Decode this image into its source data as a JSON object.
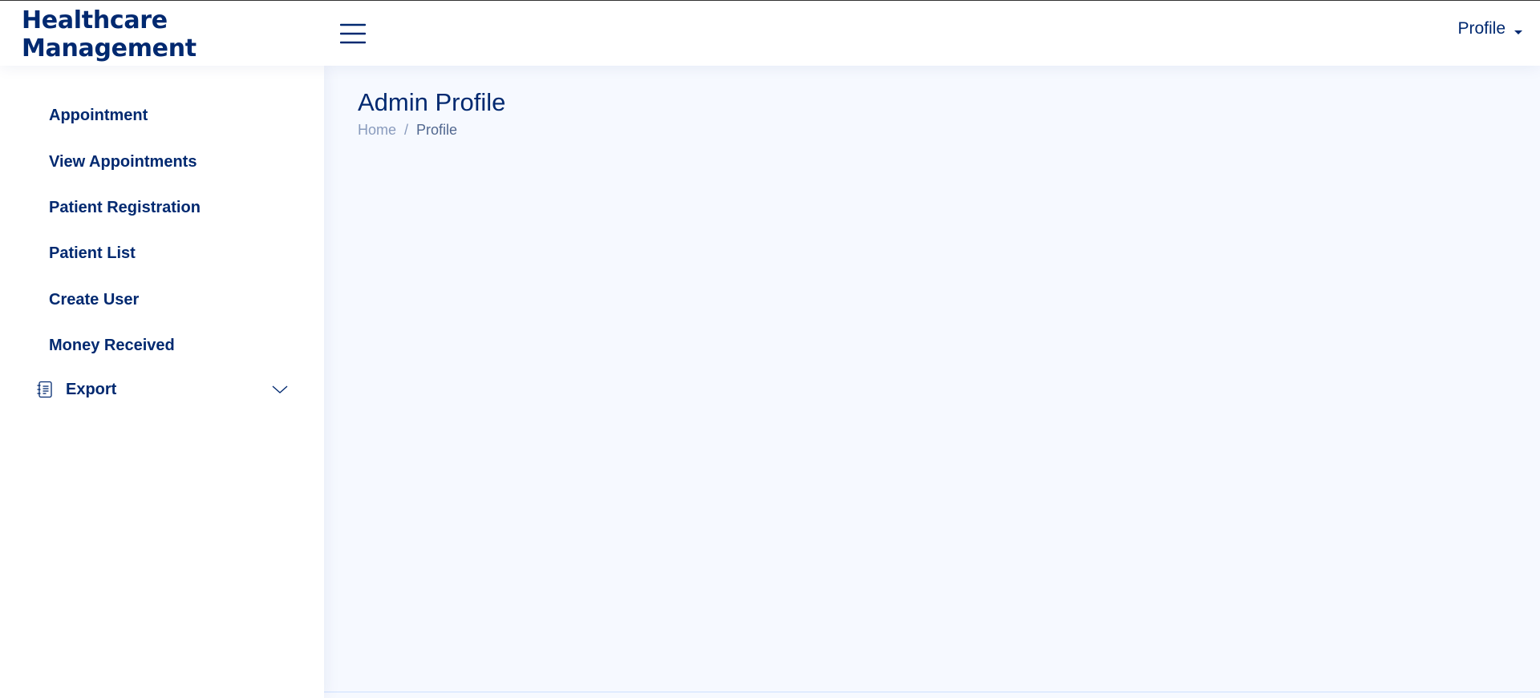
{
  "header": {
    "brand": "Healthcare Management",
    "menu_toggle_icon": "hamburger-icon",
    "profile_label": "Profile",
    "profile_caret_icon": "caret-down-icon"
  },
  "sidebar": {
    "items": [
      {
        "label": "Appointment"
      },
      {
        "label": "View Appointments"
      },
      {
        "label": "Patient Registration"
      },
      {
        "label": "Patient List"
      },
      {
        "label": "Create User"
      },
      {
        "label": "Money Received"
      }
    ],
    "export": {
      "label": "Export",
      "icon": "journal-text-icon",
      "chevron_icon": "chevron-down-icon"
    }
  },
  "main": {
    "title": "Admin Profile",
    "breadcrumb": {
      "home": "Home",
      "separator": "/",
      "current": "Profile"
    }
  },
  "colors": {
    "primary": "#012970",
    "main_background": "#f6f9ff",
    "breadcrumb_muted": "#899bbd",
    "breadcrumb_active": "#51678f"
  }
}
